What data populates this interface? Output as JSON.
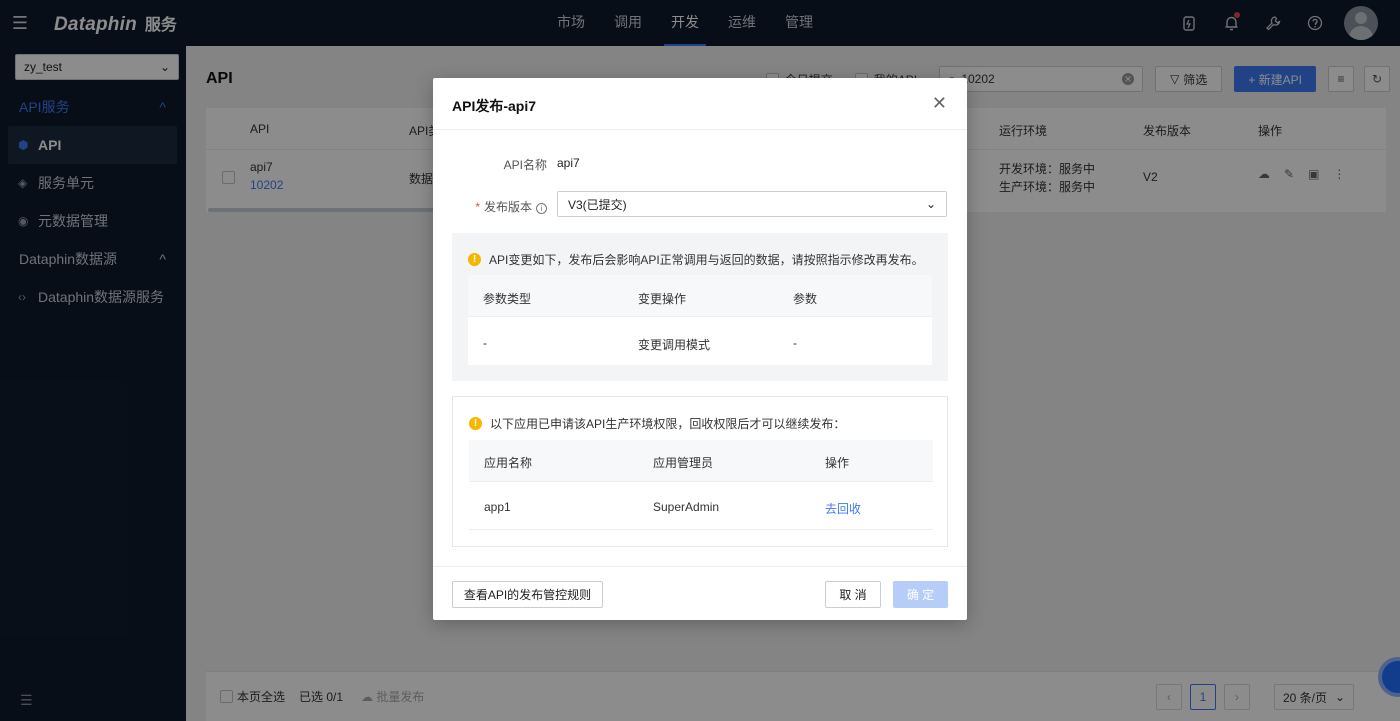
{
  "topbar": {
    "brand": "Dataphin",
    "brand_suffix": "服务",
    "nav": [
      "市场",
      "调用",
      "开发",
      "运维",
      "管理"
    ],
    "active_nav": "开发"
  },
  "sidebar": {
    "project": "zy_test",
    "group1": "API服务",
    "items": [
      "API",
      "服务单元",
      "元数据管理"
    ],
    "group2": "Dataphin数据源",
    "items2": [
      "Dataphin数据源服务"
    ]
  },
  "main": {
    "title": "API",
    "filter_today": "今日提交",
    "filter_mine": "我的API",
    "search_value": "10202",
    "filter_btn": "筛选",
    "new_btn": "+ 新建API",
    "columns": {
      "api": "API",
      "type": "API类",
      "env": "运行环境",
      "version": "发布版本",
      "ops": "操作"
    },
    "row": {
      "name": "api7",
      "id": "10202",
      "type": "数据",
      "env_dev": "开发环境：服务中",
      "env_prod": "生产环境：服务中",
      "version": "V2"
    },
    "footer": {
      "select_page": "本页全选",
      "selected": "已选 0/1",
      "batch_publish": "批量发布",
      "page": "1",
      "page_size": "20 条/页"
    }
  },
  "modal": {
    "title": "API发布-api7",
    "api_name_label": "API名称",
    "api_name_value": "api7",
    "version_label": "发布版本",
    "version_value": "V3(已提交)",
    "change_notice": "API变更如下，发布后会影响API正常调用与返回的数据，请按照指示修改再发布。",
    "change_table": {
      "headers": [
        "参数类型",
        "变更操作",
        "参数"
      ],
      "rows": [
        [
          "-",
          "变更调用模式",
          "-"
        ]
      ]
    },
    "perm_notice": "以下应用已申请该API生产环境权限，回收权限后才可以继续发布：",
    "perm_table": {
      "headers": [
        "应用名称",
        "应用管理员",
        "操作"
      ],
      "rows": [
        [
          "app1",
          "SuperAdmin",
          "去回收"
        ]
      ]
    },
    "rules_btn": "查看API的发布管控规则",
    "cancel_btn": "取 消",
    "ok_btn": "确 定"
  }
}
